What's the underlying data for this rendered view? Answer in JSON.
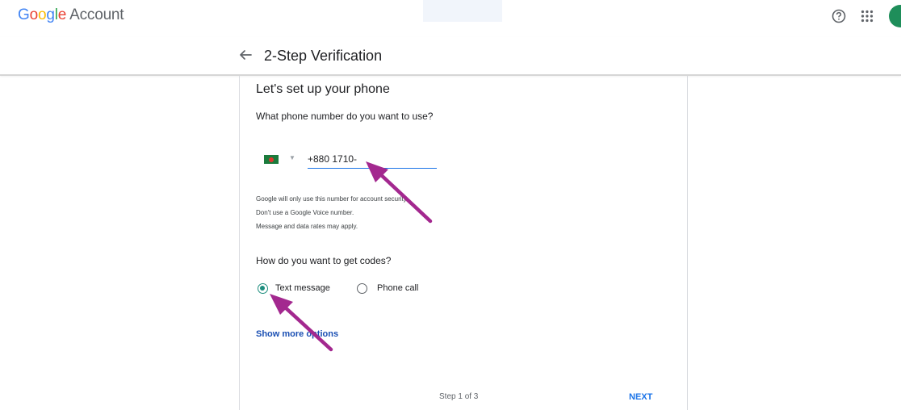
{
  "app": {
    "logo_letters": [
      "G",
      "o",
      "o",
      "g",
      "l",
      "e"
    ],
    "logo_suffix": "Account",
    "icons": [
      "help-icon",
      "apps-icon",
      "avatar"
    ]
  },
  "header": {
    "title": "2-Step Verification",
    "back_icon": "arrow-left-icon"
  },
  "card": {
    "heading": "Let's set up your phone",
    "phone_question": "What phone number do you want to use?",
    "country_flag": "bangladesh-flag",
    "phone_value": "+880 1710-",
    "notes": [
      "Google will only use this number for account security.",
      "Don't use a Google Voice number.",
      "Message and data rates may apply."
    ],
    "codes_question": "How do you want to get codes?",
    "options": [
      {
        "label": "Text message",
        "selected": true
      },
      {
        "label": "Phone call",
        "selected": false
      }
    ],
    "show_more": "Show more options",
    "step": "Step 1 of 3",
    "next": "NEXT"
  },
  "colors": {
    "accent": "#1a73e8",
    "radio_selected": "#1e8e7e",
    "annotation_arrow": "#a3288f"
  }
}
